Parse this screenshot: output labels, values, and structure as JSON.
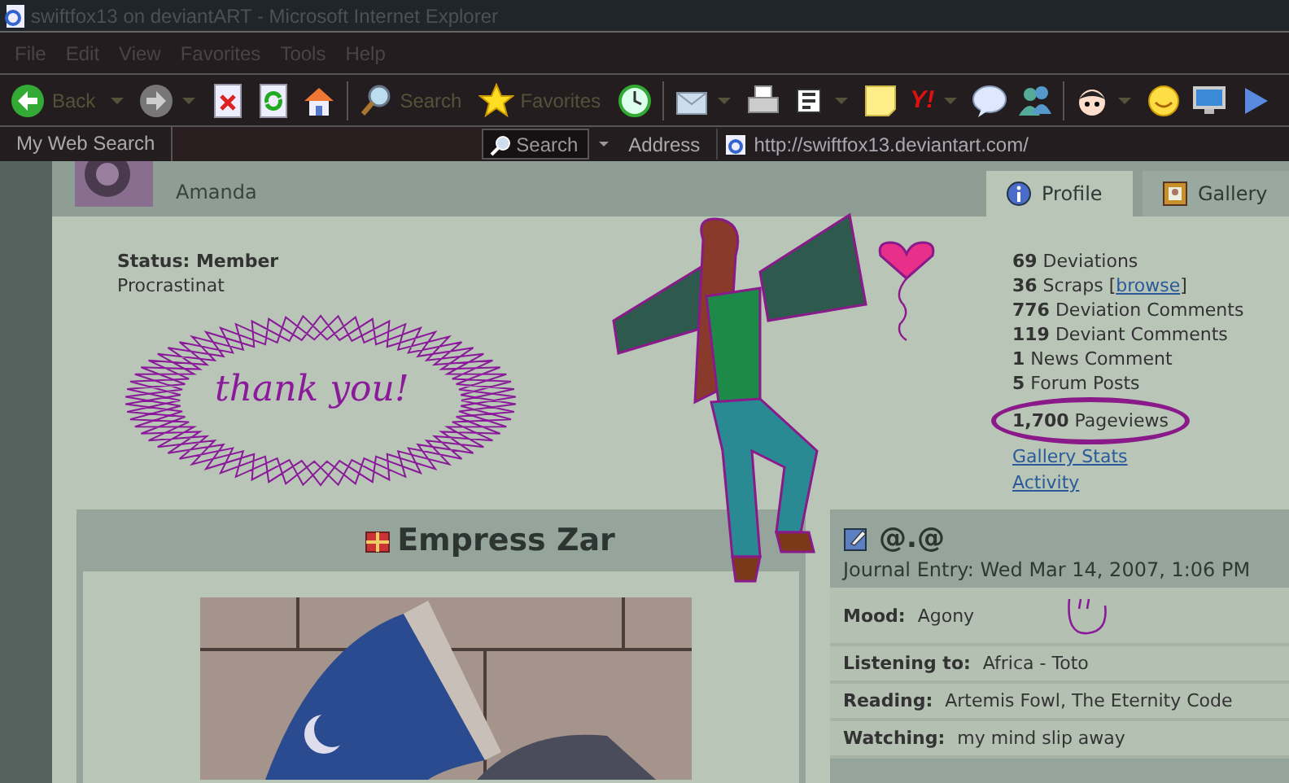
{
  "window": {
    "title": "swiftfox13 on deviantART - Microsoft Internet Explorer"
  },
  "menu": [
    "File",
    "Edit",
    "View",
    "Favorites",
    "Tools",
    "Help"
  ],
  "toolbar": [
    {
      "kind": "back",
      "label": "Back",
      "dropdown": true
    },
    {
      "kind": "forward",
      "dropdown": true
    },
    {
      "kind": "stop"
    },
    {
      "kind": "refresh"
    },
    {
      "kind": "home"
    },
    {
      "kind": "separator"
    },
    {
      "kind": "search",
      "label": "Search"
    },
    {
      "kind": "favorites",
      "label": "Favorites"
    },
    {
      "kind": "history"
    },
    {
      "kind": "separator"
    },
    {
      "kind": "mail",
      "dropdown": true
    },
    {
      "kind": "print"
    },
    {
      "kind": "edit",
      "dropdown": true
    },
    {
      "kind": "note"
    },
    {
      "kind": "yahoo",
      "label": "Y!",
      "dropdown": true
    },
    {
      "kind": "bubble"
    },
    {
      "kind": "people"
    },
    {
      "kind": "separator"
    },
    {
      "kind": "face",
      "dropdown": true
    },
    {
      "kind": "smiley"
    },
    {
      "kind": "monitor"
    },
    {
      "kind": "play"
    }
  ],
  "search_bar": {
    "label": "My Web Search",
    "button": "Search"
  },
  "address": {
    "label": "Address",
    "value": "http://swiftfox13.deviantart.com/"
  },
  "profile": {
    "name": "Amanda",
    "tabs": [
      {
        "label": "Profile",
        "selected": true
      },
      {
        "label": "Gallery",
        "selected": false
      }
    ],
    "details": [
      {
        "kind": "status",
        "text": "Status: Member"
      },
      {
        "kind": "plain",
        "text": "Procrastinat"
      }
    ],
    "doodle": {
      "text": "thank you!"
    },
    "stats": [
      {
        "count": "69",
        "label": "Deviations"
      },
      {
        "count": "36",
        "label": "Scraps [",
        "link": "browse",
        "after": "]"
      },
      {
        "count": "776",
        "label": "Deviation Comments"
      },
      {
        "count": "119",
        "label": "Deviant Comments"
      },
      {
        "count": "1",
        "label": "News Comment"
      },
      {
        "count": "5",
        "label": "Forum Posts"
      },
      {
        "count": "1,700",
        "label": "Pageviews",
        "circled": true
      }
    ],
    "links": [
      "Gallery Stats",
      "Activity"
    ]
  },
  "deviation": {
    "title": "Empress Zar"
  },
  "journal": {
    "title": "@.@",
    "date": "Journal Entry: Wed Mar 14, 2007, 1:06 PM",
    "fields": [
      {
        "label": "Mood:",
        "value": "Agony",
        "scribbled": true
      },
      {
        "label": "Listening to:",
        "value": "Africa - Toto"
      },
      {
        "label": "Reading:",
        "value": "Artemis Fowl, The Eternity Code"
      },
      {
        "label": "Watching:",
        "value": "my mind slip away"
      }
    ]
  }
}
